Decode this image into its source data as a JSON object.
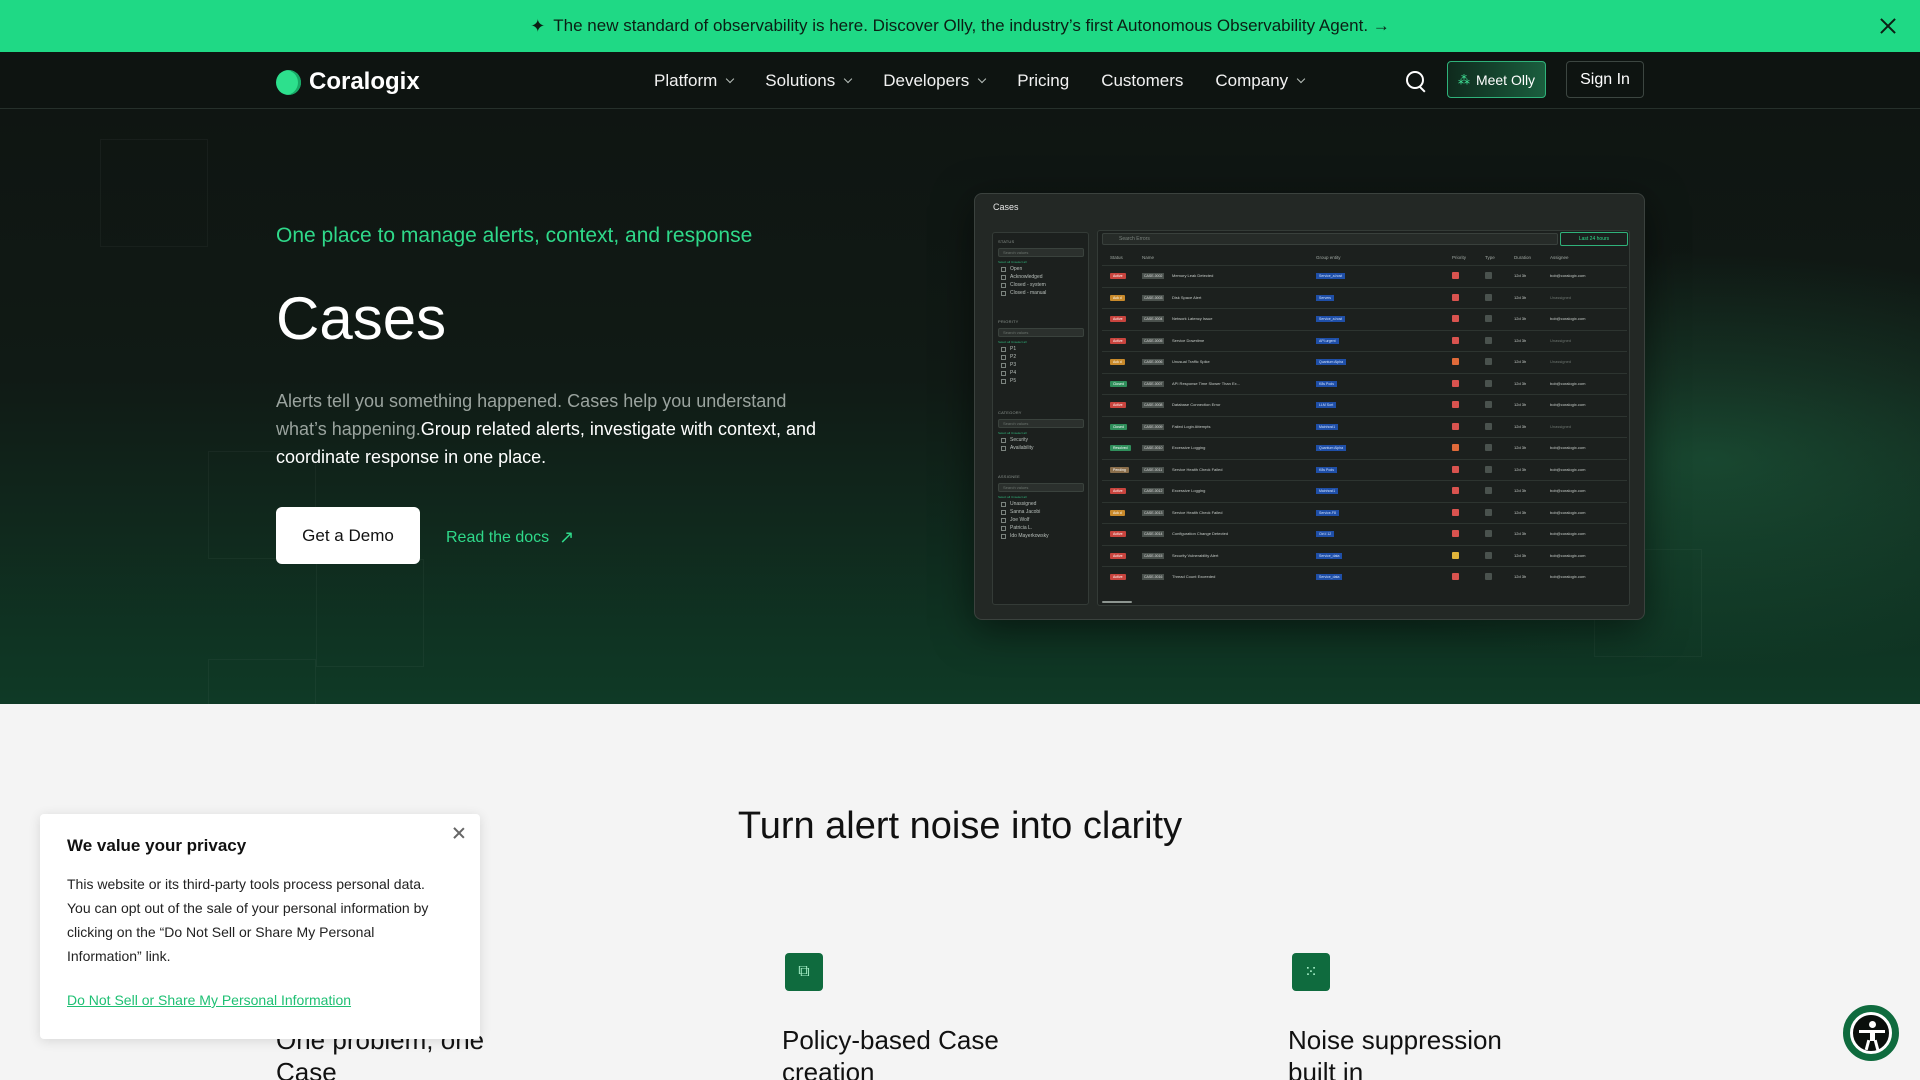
{
  "announcement": {
    "text": "The new standard of observability is here. Discover Olly, the industry’s first Autonomous Observability Agent. →"
  },
  "nav": {
    "logo": "Coralogix",
    "items": [
      {
        "label": "Platform",
        "dropdown": true
      },
      {
        "label": "Solutions",
        "dropdown": true
      },
      {
        "label": "Developers",
        "dropdown": true
      },
      {
        "label": "Pricing",
        "dropdown": false
      },
      {
        "label": "Customers",
        "dropdown": false
      },
      {
        "label": "Company",
        "dropdown": true
      }
    ],
    "meet_olly": "Meet Olly",
    "sign_in": "Sign In"
  },
  "hero": {
    "eyebrow": "One place to manage alerts, context, and response",
    "title": "Cases",
    "desc_muted": "Alerts tell you something happened. Cases help you understand what’s happening.",
    "desc_highlight": "Group related alerts, investigate with context, and coordinate response in one place.",
    "cta_demo": "Get a Demo",
    "cta_docs": "Read the docs"
  },
  "mock": {
    "title": "Cases",
    "search_placeholder": "Search Errors",
    "range": "Last 24 hours",
    "filters": [
      {
        "label": "STATUS",
        "search": "Search values",
        "sel": "Select all    Unselect all",
        "options": [
          "Open",
          "Acknowledged",
          "Closed - system",
          "Closed - manual"
        ]
      },
      {
        "label": "PRIORITY",
        "search": "Search values",
        "sel": "Select all    Unselect all",
        "options": [
          "P1",
          "P2",
          "P3",
          "P4",
          "P5"
        ]
      },
      {
        "label": "CATEGORY",
        "search": "Search values",
        "sel": "Select all    Unselect all",
        "options": [
          "Security",
          "Availability"
        ]
      },
      {
        "label": "ASSIGNEE",
        "search": "Search values",
        "sel": "Select all    Unselect all",
        "options": [
          "Unassigned",
          "Sanna Jacobi",
          "Joe Wolf",
          "Patricia L.",
          "Ido Mayerkowsky"
        ]
      }
    ],
    "columns": [
      "Status",
      "Name",
      "Group entity",
      "Priority",
      "Type",
      "Duration",
      "Assignee"
    ],
    "rows": [
      {
        "status": "Active",
        "sc": "#c8443e",
        "id": "CASE-0002",
        "name": "Memory Leak Detected",
        "group": "Service_a.host",
        "pri": "#d9534f",
        "dur": "12d 3h",
        "assignee": "bob@coralogix.com"
      },
      {
        "status": "Ack d",
        "sc": "#c98a2b",
        "id": "CASE-0003",
        "name": "Disk Space Alert",
        "group": "Servers",
        "pri": "#d9534f",
        "dur": "12d 3h",
        "assignee": "Unassigned"
      },
      {
        "status": "Active",
        "sc": "#c8443e",
        "id": "CASE-0004",
        "name": "Network Latency Issue",
        "group": "Service_a.host",
        "pri": "#d9534f",
        "dur": "12d 3h",
        "assignee": "bob@coralogix.com"
      },
      {
        "status": "Active",
        "sc": "#c8443e",
        "id": "CASE-0005",
        "name": "Service Downtime",
        "group": "API.urgent",
        "pri": "#d9534f",
        "dur": "12d 3h",
        "assignee": "Unassigned"
      },
      {
        "status": "Ack d",
        "sc": "#c98a2b",
        "id": "CASE-0006",
        "name": "Unusual Traffic Spike",
        "group": "Quantum Alpha",
        "pri": "#e06a3a",
        "dur": "12d 3h",
        "assignee": "Unassigned"
      },
      {
        "status": "Closed",
        "sc": "#2f8f5b",
        "id": "CASE-0007",
        "name": "API Response Time Slower Than Ex...",
        "group": "K8s Pods",
        "pri": "#d9534f",
        "dur": "12d 3h",
        "assignee": "bob@coralogix.com"
      },
      {
        "status": "Active",
        "sc": "#c8443e",
        "id": "CASE-0008",
        "name": "Database Connection Error",
        "group": "LLM Sort",
        "pri": "#d9534f",
        "dur": "12d 3h",
        "assignee": "bob@coralogix.com"
      },
      {
        "status": "Closed",
        "sc": "#2f8f5b",
        "id": "CASE-0009",
        "name": "Failed Login Attempts",
        "group": "Mainhost1",
        "pri": "#d9534f",
        "dur": "12d 3h",
        "assignee": "Unassigned"
      },
      {
        "status": "Resolved",
        "sc": "#2f8f5b",
        "id": "CASE-0010",
        "name": "Excessive Logging",
        "group": "Quantum Alpha",
        "pri": "#e06a3a",
        "dur": "12d 3h",
        "assignee": "bob@coralogix.com"
      },
      {
        "status": "Pending",
        "sc": "#8a6e4b",
        "id": "CASE-0011",
        "name": "Service Health Check Failed",
        "group": "K8s Pods",
        "pri": "#d9534f",
        "dur": "12d 3h",
        "assignee": "bob@coralogix.com"
      },
      {
        "status": "Active",
        "sc": "#c8443e",
        "id": "CASE-0012",
        "name": "Excessive Logging",
        "group": "Mainhost1",
        "pri": "#d9534f",
        "dur": "12d 3h",
        "assignee": "bob@coralogix.com"
      },
      {
        "status": "Ack d",
        "sc": "#c98a2b",
        "id": "CASE-0013",
        "name": "Service Health Check Failed",
        "group": "Service-F8",
        "pri": "#d9534f",
        "dur": "12d 3h",
        "assignee": "bob@coralogix.com"
      },
      {
        "status": "Active",
        "sc": "#c8443e",
        "id": "CASE-0014",
        "name": "Configuration Change Detected",
        "group": "Ctrl.f.12",
        "pri": "#d9534f",
        "dur": "12d 3h",
        "assignee": "bob@coralogix.com"
      },
      {
        "status": "Active",
        "sc": "#c8443e",
        "id": "CASE-0015",
        "name": "Security Vulnerability Alert",
        "group": "Service_data",
        "pri": "#e0b43a",
        "dur": "12d 3h",
        "assignee": "bob@coralogix.com"
      },
      {
        "status": "Active",
        "sc": "#c8443e",
        "id": "CASE-0016",
        "name": "Thread Count Exceeded",
        "group": "Service_data",
        "pri": "#d9534f",
        "dur": "12d 3h",
        "assignee": "bob@coralogix.com"
      }
    ]
  },
  "section": {
    "title": "Turn alert noise into clarity",
    "features": [
      {
        "title": "One problem, one Case",
        "icon": "case-icon"
      },
      {
        "title": "Policy-based Case creation",
        "icon": "policy-icon"
      },
      {
        "title": "Noise suppression built in",
        "icon": "noise-icon"
      }
    ]
  },
  "privacy": {
    "title": "We value your privacy",
    "body": "This website or its third-party tools process personal data. You can opt out of the sale of your personal information by clicking on the “Do Not Sell or Share My Personal Information” link.",
    "link": "Do Not Sell or Share My Personal Information"
  }
}
